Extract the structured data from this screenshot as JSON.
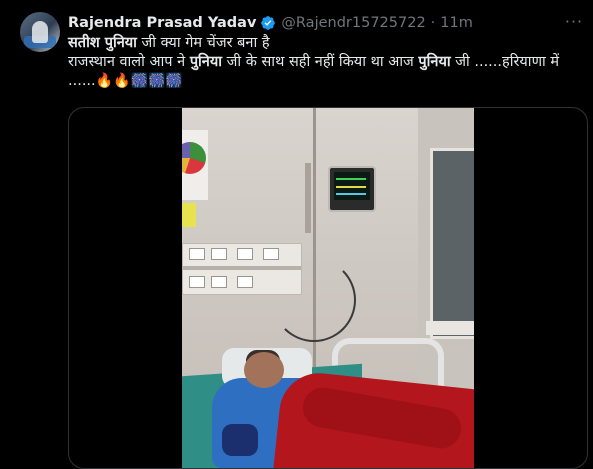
{
  "author": {
    "name": "Rajendra Prasad Yadav",
    "handle": "@Rajendr15725722",
    "separator": "·",
    "time": "11m",
    "verified": true,
    "avatar_icon": "avatar-photo"
  },
  "more_label": "···",
  "tweet": {
    "line1_bold": "सतीश पुनिया",
    "line1_rest": " जी क्या गेम चेंजर बना है",
    "line2_a": "राजस्थान वालो आप ने ",
    "line2_bold1": "पुनिया",
    "line2_b": " जी के साथ सही नहीं किया था आज ",
    "line2_bold2": "पुनिया",
    "line2_c": " जी ......हरियाणा में",
    "line3_dots": "......",
    "emojis": "🔥🔥🎆🎆🎆"
  },
  "colors": {
    "background": "#000000",
    "text": "#e7e9ea",
    "muted": "#71767b",
    "verified": "#1d9bf0",
    "border": "#2f3336"
  },
  "media": {
    "type": "video",
    "icon": "video-media"
  }
}
